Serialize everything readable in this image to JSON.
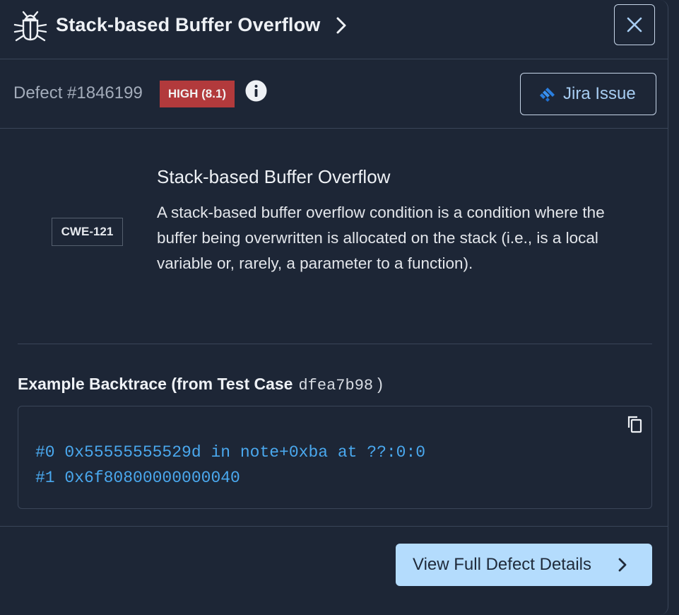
{
  "header": {
    "title": "Stack-based Buffer Overflow",
    "icon": "bug-icon",
    "close_icon": "close-icon"
  },
  "defect": {
    "id_label": "Defect #1846199",
    "severity": "HIGH (8.1)",
    "severity_color": "#b23a3c",
    "jira_label": "Jira Issue"
  },
  "cwe": {
    "id": "CWE-121",
    "title": "Stack-based Buffer Overflow",
    "description": "A stack-based buffer overflow condition is a condition where the buffer being overwritten is allocated on the stack (i.e., is a local variable or, rarely, a parameter to a function)."
  },
  "backtrace": {
    "title": "Example Backtrace (from Test Case",
    "test_case": "dfea7b98",
    "close_paren": ")",
    "lines": [
      "#0 0x55555555529d in note+0xba at ??:0:0",
      "#1 0x6f80800000000040"
    ]
  },
  "footer": {
    "view_label": "View Full Defect Details"
  },
  "colors": {
    "background": "#1d2636",
    "accent": "#b4dcfd",
    "code": "#4aa8ee"
  }
}
